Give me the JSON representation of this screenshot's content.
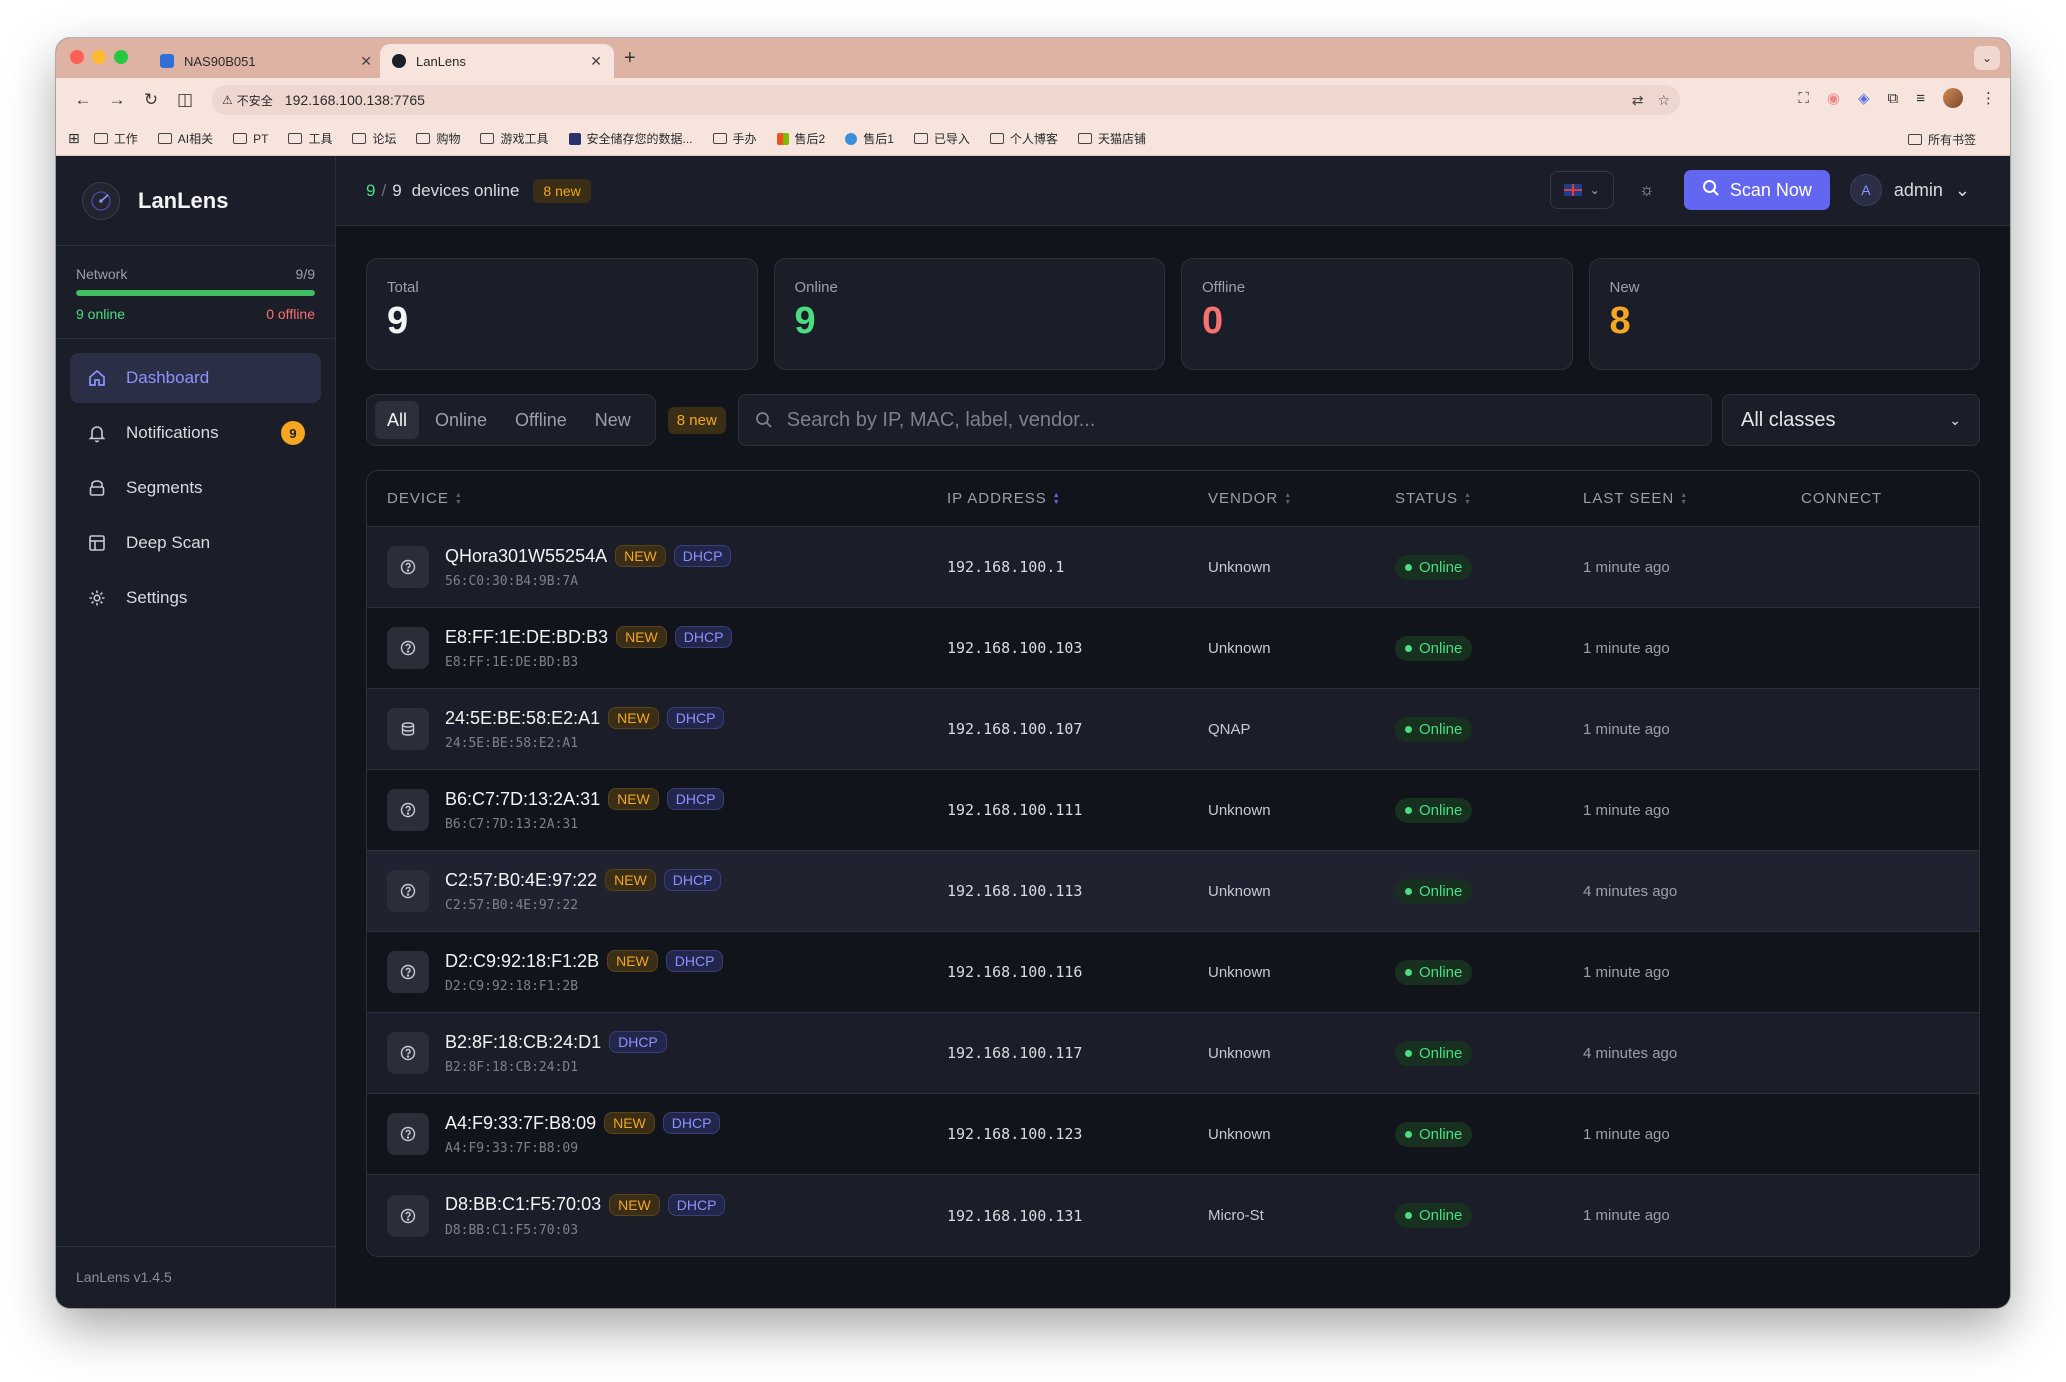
{
  "browser": {
    "tabs": [
      {
        "label": "NAS90B051"
      },
      {
        "label": "LanLens"
      }
    ],
    "insecure_label": "不安全",
    "url": "192.168.100.138:7765",
    "bookmarks": [
      "工作",
      "AI相关",
      "PT",
      "工具",
      "论坛",
      "购物",
      "游戏工具",
      "安全储存您的数据...",
      "手办",
      "售后2",
      "售后1",
      "已导入",
      "个人博客",
      "天猫店铺"
    ],
    "all_bookmarks": "所有书签"
  },
  "sidebar": {
    "brand": "LanLens",
    "network_label": "Network",
    "network_ratio": "9/9",
    "network_fill": 1.0,
    "online_text": "9 online",
    "offline_text": "0 offline",
    "items": [
      {
        "label": "Dashboard",
        "icon": "home-icon",
        "active": true
      },
      {
        "label": "Notifications",
        "icon": "bell-icon",
        "badge": "9"
      },
      {
        "label": "Segments",
        "icon": "layers-icon"
      },
      {
        "label": "Deep Scan",
        "icon": "grid-icon"
      },
      {
        "label": "Settings",
        "icon": "gear-icon"
      }
    ],
    "version": "LanLens v1.4.5"
  },
  "topbar": {
    "online_count": "9",
    "total_count": "9",
    "status_text": "devices online",
    "new_badge": "8 new",
    "scan_label": "Scan Now",
    "user_initial": "A",
    "user_name": "admin"
  },
  "stats": [
    {
      "label": "Total",
      "value": "9",
      "color": "#f3f4f6"
    },
    {
      "label": "Online",
      "value": "9",
      "color": "#4ade80"
    },
    {
      "label": "Offline",
      "value": "0",
      "color": "#f87171"
    },
    {
      "label": "New",
      "value": "8",
      "color": "#f5a623"
    }
  ],
  "filters": {
    "tabs": [
      "All",
      "Online",
      "Offline",
      "New"
    ],
    "active": "All",
    "new_badge": "8 new",
    "search_placeholder": "Search by IP, MAC, label, vendor...",
    "class_select": "All classes"
  },
  "table": {
    "headers": {
      "device": "DEVICE",
      "ip": "IP ADDRESS",
      "vendor": "VENDOR",
      "status": "STATUS",
      "last_seen": "LAST SEEN",
      "connect": "CONNECT"
    },
    "new_label": "NEW",
    "dhcp_label": "DHCP",
    "rows": [
      {
        "name": "QHora301W55254A",
        "mac": "56:C0:30:B4:9B:7A",
        "ip": "192.168.100.1",
        "vendor": "Unknown",
        "status": "Online",
        "seen": "1 minute ago",
        "is_new": true,
        "icon": "question-icon"
      },
      {
        "name": "E8:FF:1E:DE:BD:B3",
        "mac": "E8:FF:1E:DE:BD:B3",
        "ip": "192.168.100.103",
        "vendor": "Unknown",
        "status": "Online",
        "seen": "1 minute ago",
        "is_new": true,
        "icon": "question-icon"
      },
      {
        "name": "24:5E:BE:58:E2:A1",
        "mac": "24:5E:BE:58:E2:A1",
        "ip": "192.168.100.107",
        "vendor": "QNAP",
        "status": "Online",
        "seen": "1 minute ago",
        "is_new": true,
        "icon": "storage-icon"
      },
      {
        "name": "B6:C7:7D:13:2A:31",
        "mac": "B6:C7:7D:13:2A:31",
        "ip": "192.168.100.111",
        "vendor": "Unknown",
        "status": "Online",
        "seen": "1 minute ago",
        "is_new": true,
        "icon": "question-icon"
      },
      {
        "name": "C2:57:B0:4E:97:22",
        "mac": "C2:57:B0:4E:97:22",
        "ip": "192.168.100.113",
        "vendor": "Unknown",
        "status": "Online",
        "seen": "4 minutes ago",
        "is_new": true,
        "icon": "question-icon",
        "highlight": true
      },
      {
        "name": "D2:C9:92:18:F1:2B",
        "mac": "D2:C9:92:18:F1:2B",
        "ip": "192.168.100.116",
        "vendor": "Unknown",
        "status": "Online",
        "seen": "1 minute ago",
        "is_new": true,
        "icon": "question-icon"
      },
      {
        "name": "B2:8F:18:CB:24:D1",
        "mac": "B2:8F:18:CB:24:D1",
        "ip": "192.168.100.117",
        "vendor": "Unknown",
        "status": "Online",
        "seen": "4 minutes ago",
        "is_new": false,
        "icon": "question-icon"
      },
      {
        "name": "A4:F9:33:7F:B8:09",
        "mac": "A4:F9:33:7F:B8:09",
        "ip": "192.168.100.123",
        "vendor": "Unknown",
        "status": "Online",
        "seen": "1 minute ago",
        "is_new": true,
        "icon": "question-icon"
      },
      {
        "name": "D8:BB:C1:F5:70:03",
        "mac": "D8:BB:C1:F5:70:03",
        "ip": "192.168.100.131",
        "vendor": "Micro-St",
        "status": "Online",
        "seen": "1 minute ago",
        "is_new": true,
        "icon": "question-icon"
      }
    ]
  }
}
